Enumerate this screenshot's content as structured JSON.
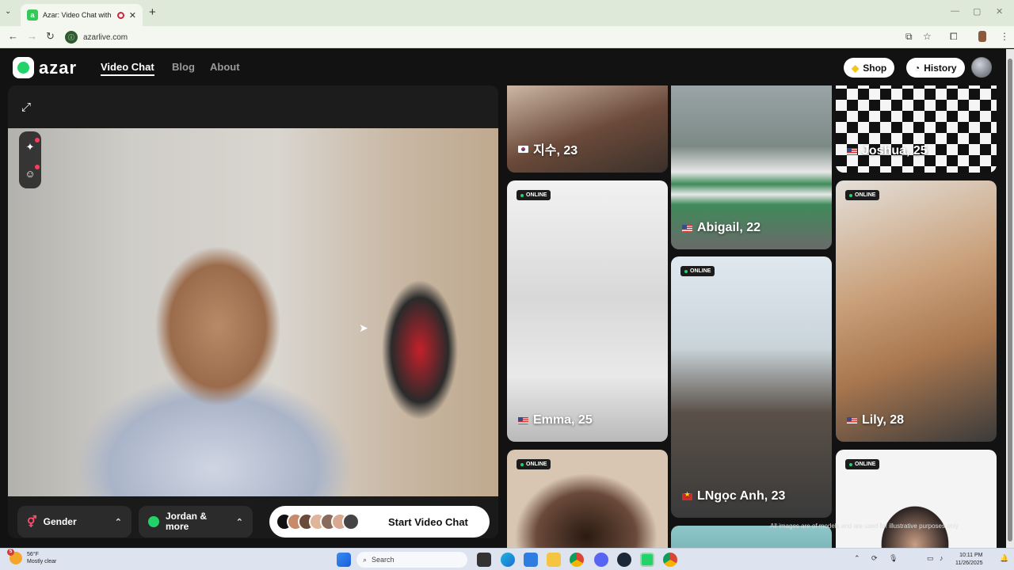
{
  "browser": {
    "tab_title": "Azar: Video Chat with New",
    "url": "azarlive.com"
  },
  "nav": {
    "brand": "azar",
    "links": [
      "Video Chat",
      "Blog",
      "About"
    ],
    "shop": "Shop",
    "history": "History"
  },
  "controls": {
    "gender": "Gender",
    "region": "Jordan & more",
    "start": "Start Video Chat"
  },
  "colors": {
    "accent_green": "#23d36a",
    "online_badge": "#1c1c1c"
  },
  "grid": {
    "online_label": "ONLINE",
    "cards": [
      {
        "name": "지수, 23",
        "flag": "kr",
        "online": false
      },
      {
        "name": "Abigail, 22",
        "flag": "us",
        "online": false
      },
      {
        "name": "Joshua, 25",
        "flag": "us",
        "online": false
      },
      {
        "name": "Emma, 25",
        "flag": "us",
        "online": true
      },
      {
        "name": "LNgọc Anh, 23",
        "flag": "vn",
        "online": true
      },
      {
        "name": "Lily, 28",
        "flag": "us",
        "online": true
      },
      {
        "name": "",
        "flag": "",
        "online": true
      },
      {
        "name": "",
        "flag": "",
        "online": true
      }
    ],
    "disclaimer": "All images are of models and are used for illustrative purposes only"
  },
  "taskbar": {
    "weather_temp": "56°F",
    "weather_desc": "Mostly clear",
    "weather_badge": "5",
    "search_placeholder": "Search",
    "time": "10:11 PM",
    "date": "11/26/2025"
  }
}
